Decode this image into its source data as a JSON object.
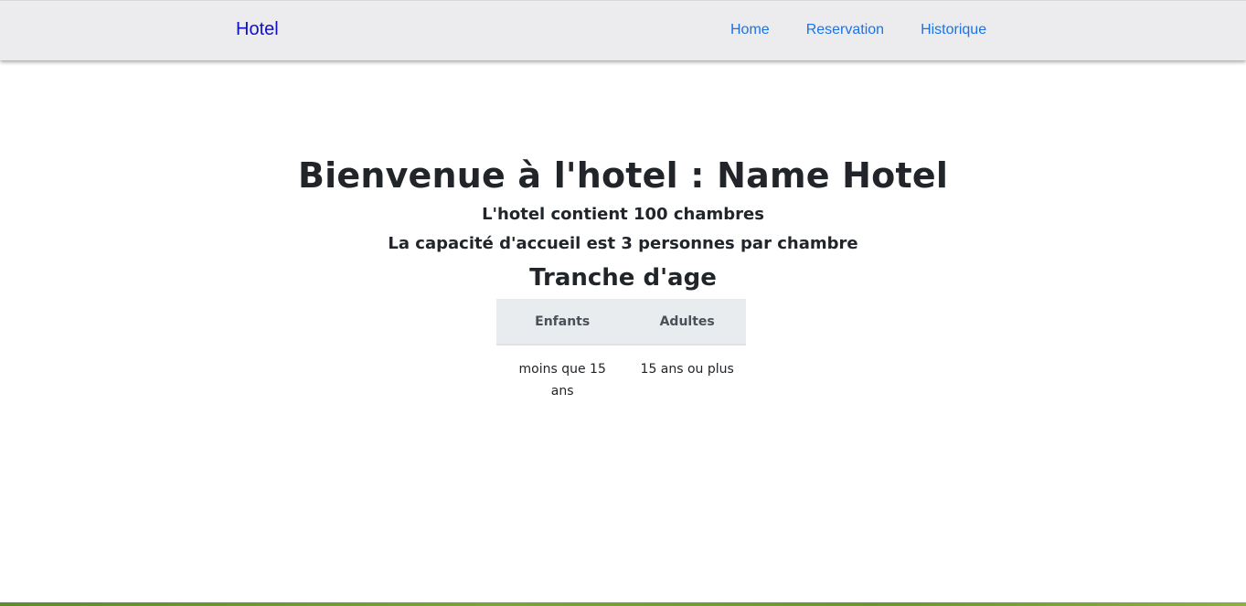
{
  "navbar": {
    "brand": "Hotel",
    "links": [
      {
        "label": "Home"
      },
      {
        "label": "Reservation"
      },
      {
        "label": "Historique"
      }
    ]
  },
  "main": {
    "title": "Bienvenue à l'hotel : Name Hotel",
    "rooms_text": "L'hotel contient 100 chambres",
    "capacity_text": "La capacité d'accueil est 3 personnes par chambre",
    "age_title": "Tranche d'age",
    "age_table": {
      "headers": [
        "Enfants",
        "Adultes"
      ],
      "rows": [
        [
          "moins que 15 ans",
          "15 ans ou plus"
        ]
      ]
    }
  },
  "colors": {
    "brand": "#1010c8",
    "nav_link": "#1a73e8",
    "navbar_bg": "#ececee",
    "table_header_bg": "#e9ecef"
  }
}
